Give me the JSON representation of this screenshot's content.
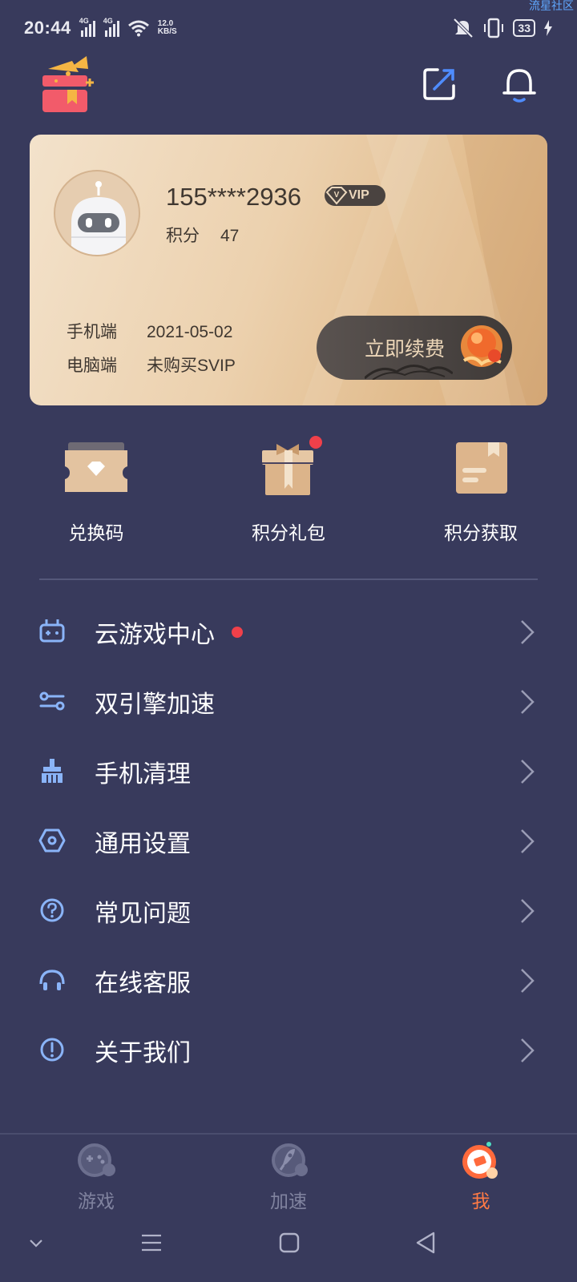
{
  "status_bar": {
    "time": "20:44",
    "net1": "4G",
    "net2": "4G",
    "speed_value": "12.0",
    "speed_unit": "KB/S",
    "battery": "33",
    "watermark": "流星社区"
  },
  "header": {
    "gift_icon": "gift-box-icon",
    "edit_icon": "external-edit-icon",
    "bell_icon": "bell-icon"
  },
  "card": {
    "phone": "155****2936",
    "vip_badge": "VIP",
    "points_label": "积分",
    "points_value": "47",
    "mobile_label": "手机端",
    "mobile_value": "2021-05-02",
    "pc_label": "电脑端",
    "pc_value": "未购买SVIP",
    "renew_label": "立即续费"
  },
  "quick_actions": [
    {
      "label": "兑换码",
      "icon": "ticket-icon"
    },
    {
      "label": "积分礼包",
      "icon": "gift-package-icon",
      "badge_color": "#f0404a"
    },
    {
      "label": "积分获取",
      "icon": "note-book-icon"
    }
  ],
  "menu": [
    {
      "label": "云游戏中心",
      "icon": "gamepad-icon",
      "has_dot": true
    },
    {
      "label": "双引擎加速",
      "icon": "engine-icon",
      "has_dot": false
    },
    {
      "label": "手机清理",
      "icon": "broom-icon",
      "has_dot": false
    },
    {
      "label": "通用设置",
      "icon": "settings-hexagon-icon",
      "has_dot": false
    },
    {
      "label": "常见问题",
      "icon": "question-icon",
      "has_dot": false
    },
    {
      "label": "在线客服",
      "icon": "headset-icon",
      "has_dot": false
    },
    {
      "label": "关于我们",
      "icon": "info-icon",
      "has_dot": false
    }
  ],
  "bottom_nav": [
    {
      "label": "游戏",
      "icon": "game-tab-icon",
      "active": false
    },
    {
      "label": "加速",
      "icon": "rocket-tab-icon",
      "active": false
    },
    {
      "label": "我",
      "icon": "me-tab-icon",
      "active": true
    }
  ],
  "colors": {
    "background": "#383a5c",
    "accent": "#ff7a45",
    "icon_blue": "#8ab4f8",
    "dot_red": "#f0404a"
  }
}
